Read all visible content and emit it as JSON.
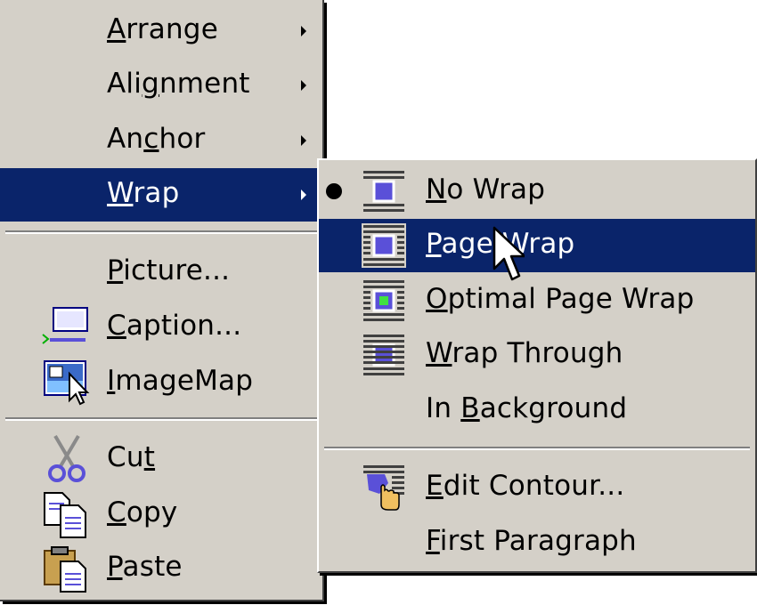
{
  "main_menu": {
    "items": [
      {
        "pre": "",
        "acc": "A",
        "post": "rrange"
      },
      {
        "pre": "Ali",
        "acc": "g",
        "post": "nment"
      },
      {
        "pre": "An",
        "acc": "c",
        "post": "hor"
      },
      {
        "pre": "",
        "acc": "W",
        "post": "rap"
      },
      {
        "pre": "",
        "acc": "P",
        "post": "icture..."
      },
      {
        "pre": "",
        "acc": "C",
        "post": "aption..."
      },
      {
        "pre": "",
        "acc": "I",
        "post": "mageMap"
      },
      {
        "pre": "Cu",
        "acc": "t",
        "post": ""
      },
      {
        "pre": "",
        "acc": "C",
        "post": "opy"
      },
      {
        "pre": "",
        "acc": "P",
        "post": "aste"
      }
    ]
  },
  "wrap_submenu": {
    "items": [
      {
        "pre": "",
        "acc": "N",
        "post": "o Wrap"
      },
      {
        "pre": "",
        "acc": "P",
        "post": "age Wrap"
      },
      {
        "pre": "",
        "acc": "O",
        "post": "ptimal Page Wrap"
      },
      {
        "pre": "",
        "acc": "W",
        "post": "rap Through"
      },
      {
        "pre": "In ",
        "acc": "B",
        "post": "ackground"
      },
      {
        "pre": "",
        "acc": "E",
        "post": "dit Contour..."
      },
      {
        "pre": "",
        "acc": "F",
        "post": "irst Paragraph"
      }
    ]
  },
  "colors": {
    "menu_bg": "#d4d0c8",
    "highlight": "#0a246a",
    "icon_accent": "#5a50d8"
  },
  "icons": [
    "caption-icon",
    "imagemap-icon",
    "scissors-icon",
    "copy-icon",
    "paste-icon",
    "no-wrap-icon",
    "page-wrap-icon",
    "optimal-page-wrap-icon",
    "wrap-through-icon",
    "edit-contour-icon",
    "mouse-pointer-icon"
  ]
}
